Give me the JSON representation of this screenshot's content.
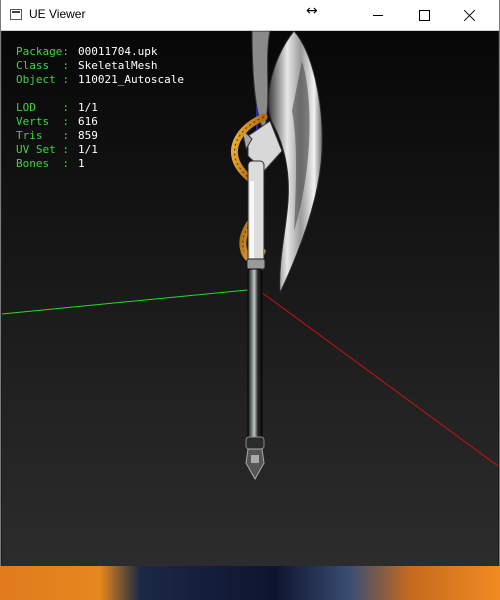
{
  "window": {
    "title": "UE Viewer"
  },
  "info": {
    "package": {
      "label": "Package:",
      "value": "00011704.upk"
    },
    "class": {
      "label": "Class  :",
      "value": "SkeletalMesh"
    },
    "object": {
      "label": "Object :",
      "value": "110021_Autoscale"
    },
    "lod": {
      "label": "LOD    :",
      "value": "1/1"
    },
    "verts": {
      "label": "Verts  :",
      "value": "616"
    },
    "tris": {
      "label": "Tris   :",
      "value": "859"
    },
    "uvset": {
      "label": "UV Set :",
      "value": "1/1"
    },
    "bones": {
      "label": "Bones  :",
      "value": "1"
    }
  },
  "colors": {
    "label_green": "#3fd43f",
    "axis_green": "#22dd22",
    "axis_red": "#cc1111",
    "axis_blue": "#2222cc"
  }
}
